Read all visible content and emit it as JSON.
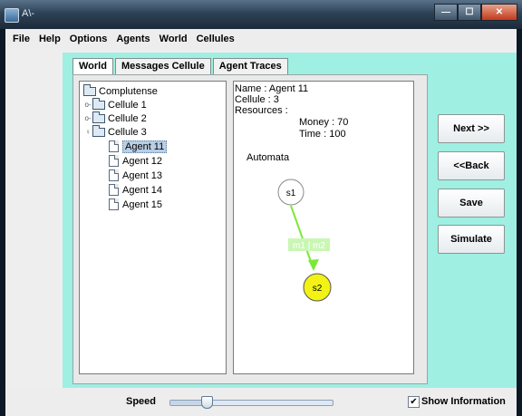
{
  "window": {
    "title": "A\\-"
  },
  "menu": [
    "File",
    "Help",
    "Options",
    "Agents",
    "World",
    "Cellules"
  ],
  "tabs": [
    "World",
    "Messages Cellule",
    "Agent Traces"
  ],
  "tree": [
    {
      "label": "Complutense",
      "level": 0,
      "type": "folder",
      "handle": ""
    },
    {
      "label": "Cellule 1",
      "level": 1,
      "type": "folder",
      "handle": "o-"
    },
    {
      "label": "Cellule 2",
      "level": 1,
      "type": "folder",
      "handle": "o-"
    },
    {
      "label": "Cellule 3",
      "level": 1,
      "type": "folder",
      "handle": "♀"
    },
    {
      "label": "Agent 11",
      "level": 2,
      "type": "leaf",
      "selected": true
    },
    {
      "label": "Agent 12",
      "level": 2,
      "type": "leaf"
    },
    {
      "label": "Agent 13",
      "level": 2,
      "type": "leaf"
    },
    {
      "label": "Agent 14",
      "level": 2,
      "type": "leaf"
    },
    {
      "label": "Agent 15",
      "level": 2,
      "type": "leaf"
    }
  ],
  "agent_info": {
    "name": "Name : Agent 11",
    "cellule": "Cellule : 3",
    "resources": "Resources :",
    "money": "Money :  70",
    "time": "Time  : 100",
    "automata_label": "Automata"
  },
  "automata": {
    "states": [
      "s1",
      "s2"
    ],
    "transition_label": "m1 | m2",
    "colors": {
      "s2_fill": "#f2f215",
      "edge": "#7be838",
      "label_bg": "#c9f7b3"
    }
  },
  "buttons": {
    "next": "Next >>",
    "back": "<<Back",
    "save": "Save",
    "simulate": "Simulate"
  },
  "bottom": {
    "speed_label": "Speed",
    "speed_value": 0.22,
    "show_info_label": "Show Information",
    "show_info_checked": true
  },
  "colors": {
    "panel_bg": "#9fefe2"
  }
}
